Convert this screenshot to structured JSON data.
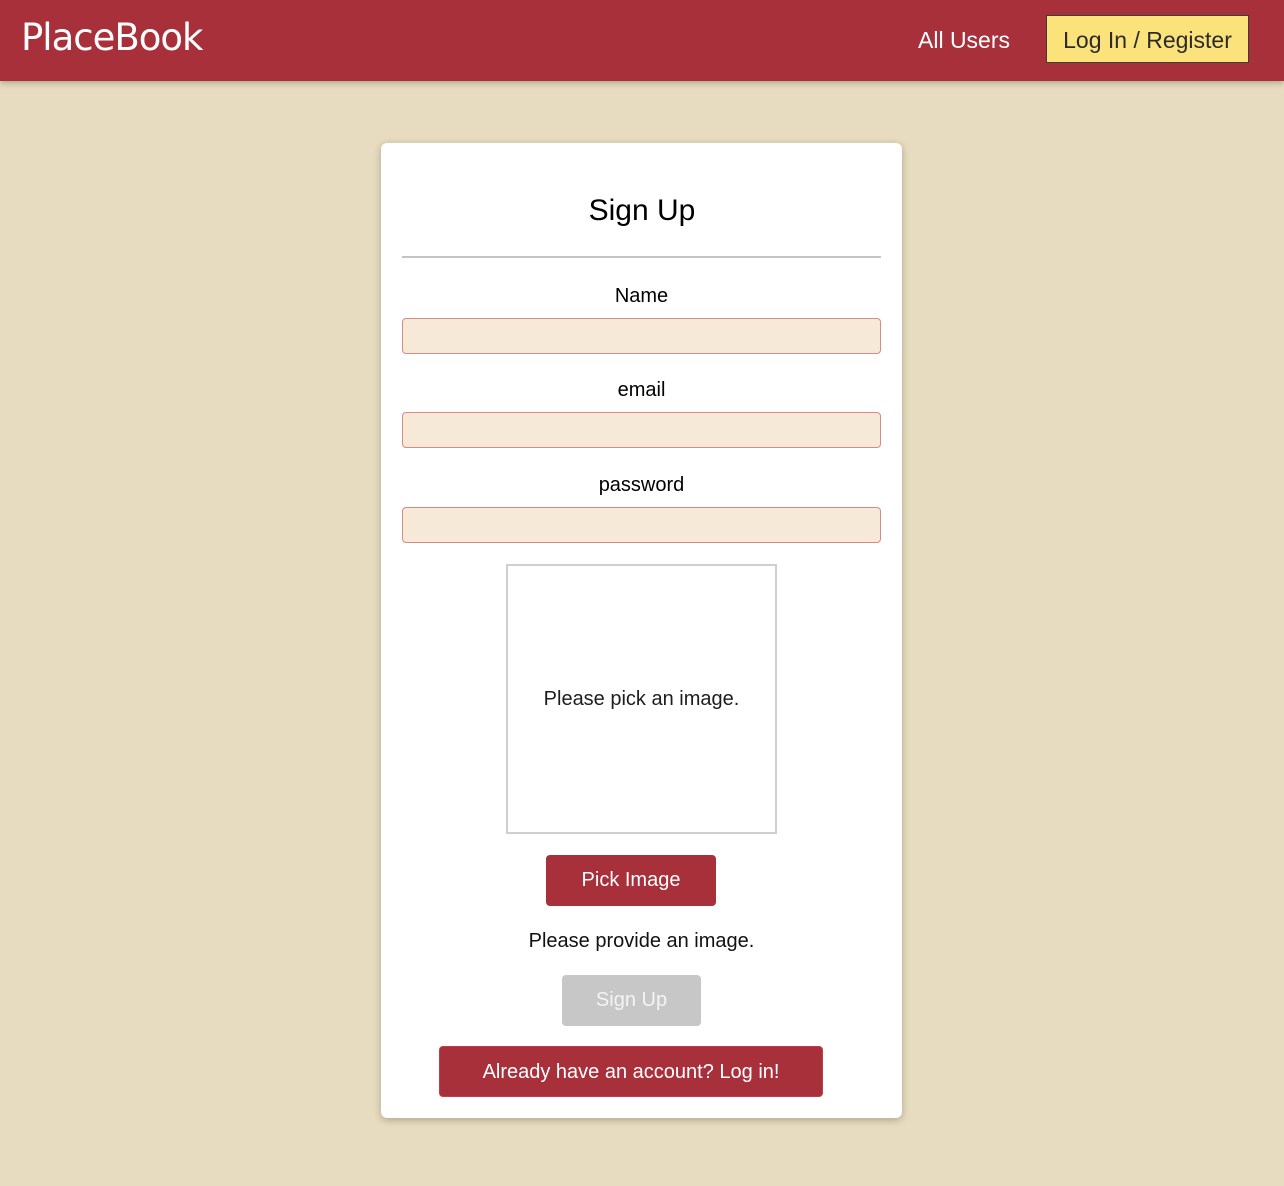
{
  "header": {
    "logo": "PlaceBook",
    "nav": {
      "all_users": "All Users",
      "auth": "Log In / Register"
    }
  },
  "form": {
    "title": "Sign Up",
    "fields": {
      "name": {
        "label": "Name",
        "value": "",
        "placeholder": ""
      },
      "email": {
        "label": "email",
        "value": "",
        "placeholder": ""
      },
      "password": {
        "label": "password",
        "value": "",
        "placeholder": ""
      }
    },
    "image_upload": {
      "preview_text": "Please pick an image.",
      "pick_button": "Pick Image",
      "error_text": "Please provide an image."
    },
    "submit_button": "Sign Up",
    "switch_button": "Already have an account? Log in!"
  },
  "colors": {
    "header_bg": "#a8303b",
    "page_bg": "#e7dcbf",
    "accent_button": "#fbe27a",
    "input_bg": "#f7e9d8",
    "input_border": "#d98a86",
    "disabled_button": "#c7c7c7"
  }
}
